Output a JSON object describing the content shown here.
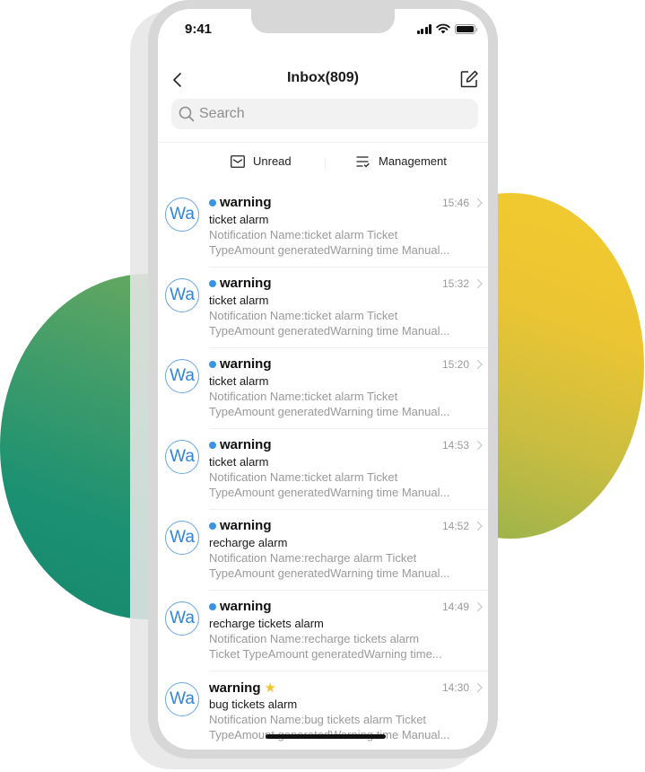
{
  "status_bar": {
    "time": "9:41"
  },
  "header": {
    "title": "Inbox(809)"
  },
  "search": {
    "placeholder": "Search",
    "value": ""
  },
  "filters": {
    "unread_label": "Unread",
    "management_label": "Management"
  },
  "colors": {
    "accent_blue": "#3b93e3",
    "star_yellow": "#f4c430",
    "blob_green": "#1c9172",
    "blob_yellow": "#f3ca2e"
  },
  "messages": [
    {
      "avatar": "Wa",
      "sender": "warning",
      "unread": true,
      "starred": false,
      "time": "15:46",
      "subject": "ticket alarm",
      "preview_line1": "Notification Name:ticket alarm Ticket",
      "preview_line2": "TypeAmount generatedWarning time Manual..."
    },
    {
      "avatar": "Wa",
      "sender": "warning",
      "unread": true,
      "starred": false,
      "time": "15:32",
      "subject": "ticket alarm",
      "preview_line1": "Notification Name:ticket alarm Ticket",
      "preview_line2": "TypeAmount generatedWarning time Manual..."
    },
    {
      "avatar": "Wa",
      "sender": "warning",
      "unread": true,
      "starred": false,
      "time": "15:20",
      "subject": "ticket alarm",
      "preview_line1": "Notification Name:ticket alarm Ticket",
      "preview_line2": "TypeAmount generatedWarning time Manual..."
    },
    {
      "avatar": "Wa",
      "sender": "warning",
      "unread": true,
      "starred": false,
      "time": "14:53",
      "subject": "ticket alarm",
      "preview_line1": "Notification Name:ticket alarm Ticket",
      "preview_line2": "TypeAmount generatedWarning time Manual..."
    },
    {
      "avatar": "Wa",
      "sender": "warning",
      "unread": true,
      "starred": false,
      "time": "14:52",
      "subject": "recharge alarm",
      "preview_line1": "Notification Name:recharge alarm Ticket",
      "preview_line2": "TypeAmount generatedWarning time Manual..."
    },
    {
      "avatar": "Wa",
      "sender": "warning",
      "unread": true,
      "starred": false,
      "time": "14:49",
      "subject": "recharge tickets alarm",
      "preview_line1": "Notification Name:recharge tickets alarm",
      "preview_line2": "Ticket TypeAmount generatedWarning time..."
    },
    {
      "avatar": "Wa",
      "sender": "warning",
      "unread": false,
      "starred": true,
      "time": "14:30",
      "subject": "bug tickets alarm",
      "preview_line1": "Notification Name:bug tickets alarm Ticket",
      "preview_line2": "TypeAmount generatedWarning time Manual..."
    }
  ]
}
